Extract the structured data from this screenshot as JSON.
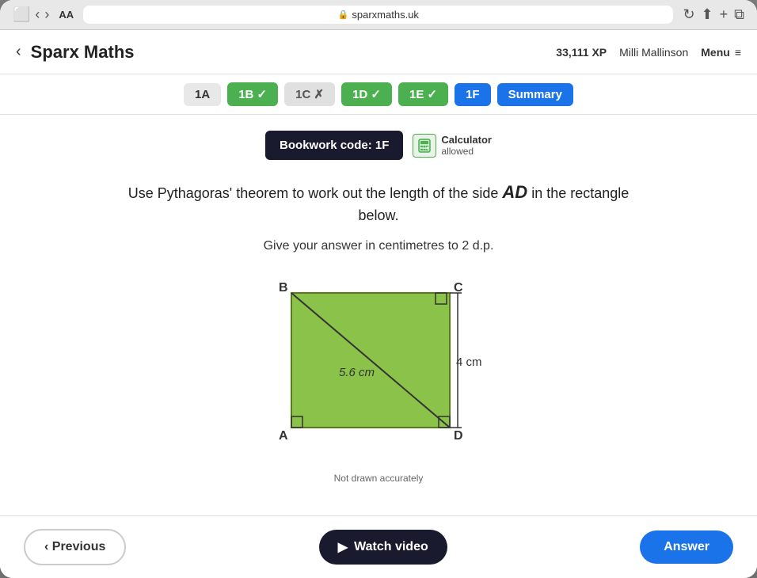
{
  "browser": {
    "aa_label": "AA",
    "url": "sparxmaths.uk",
    "lock_icon": "🔒"
  },
  "header": {
    "back_icon": "‹",
    "title": "Sparx Maths",
    "xp": "33,111 XP",
    "user": "Milli Mallinson",
    "menu_label": "Menu",
    "hamburger": "≡"
  },
  "tabs": [
    {
      "id": "1A",
      "label": "1A",
      "state": "default"
    },
    {
      "id": "1B",
      "label": "1B ✓",
      "state": "check"
    },
    {
      "id": "1C",
      "label": "1C ✗",
      "state": "cross"
    },
    {
      "id": "1D",
      "label": "1D ✓",
      "state": "check"
    },
    {
      "id": "1E",
      "label": "1E ✓",
      "state": "check"
    },
    {
      "id": "1F",
      "label": "1F",
      "state": "active"
    },
    {
      "id": "Summary",
      "label": "Summary",
      "state": "summary"
    }
  ],
  "bookwork": {
    "label": "Bookwork code: 1F",
    "calculator_icon": "📋",
    "calculator_text": "Calculator",
    "allowed_text": "allowed"
  },
  "question": {
    "line1": "Use Pythagoras' theorem to work out the length of the side ",
    "side": "AD",
    "line2": " in the rectangle",
    "line3": "below.",
    "line4": "Give your answer in centimetres to 2 d.p."
  },
  "diagram": {
    "diagonal_label": "5.6 cm",
    "side_label": "4 cm",
    "corners": {
      "B": "B",
      "C": "C",
      "A": "A",
      "D": "D"
    },
    "not_drawn": "Not drawn accurately"
  },
  "buttons": {
    "previous": "‹ Previous",
    "watch_video": "Watch video",
    "answer": "Answer"
  }
}
